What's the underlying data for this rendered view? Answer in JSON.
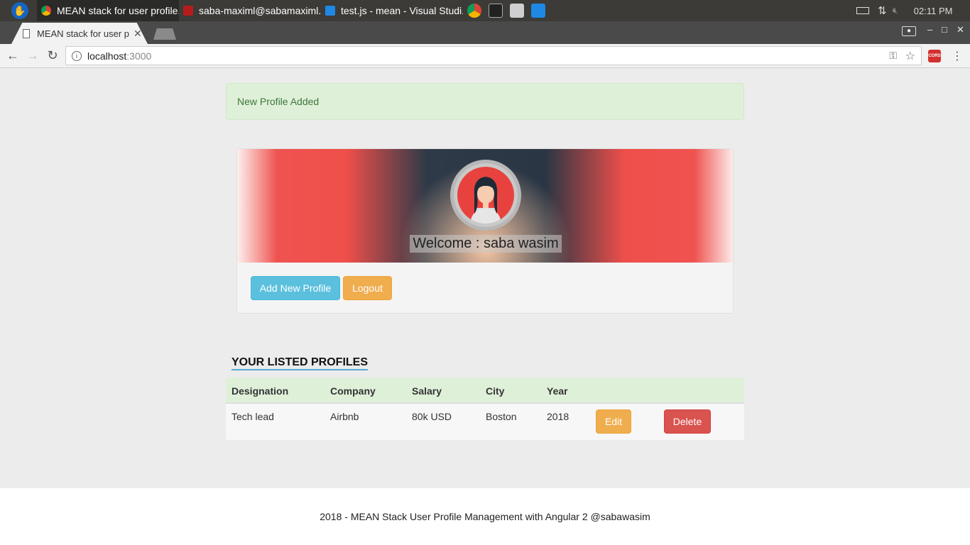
{
  "taskbar": {
    "tasks": [
      {
        "label": "MEAN stack for user profile..."
      },
      {
        "label": "saba-maximl@sabamaximl..."
      },
      {
        "label": "test.js - mean - Visual Studi..."
      }
    ],
    "clock": "02:11 PM"
  },
  "browser": {
    "tab_title": "MEAN stack for user p",
    "url_host": "localhost",
    "url_port": ":3000",
    "cors_label": "CORS"
  },
  "page": {
    "alert": "New Profile Added",
    "welcome": "Welcome : saba wasim",
    "add_profile_label": "Add New Profile",
    "logout_label": "Logout",
    "section_title": "YOUR LISTED PROFILES",
    "table": {
      "headers": [
        "Designation",
        "Company",
        "Salary",
        "City",
        "Year"
      ],
      "rows": [
        {
          "designation": "Tech lead",
          "company": "Airbnb",
          "salary": "80k USD",
          "city": "Boston",
          "year": "2018",
          "edit_label": "Edit",
          "delete_label": "Delete"
        }
      ]
    },
    "footer": "2018 - MEAN Stack User Profile Management with Angular 2 @sabawasim"
  },
  "colors": {
    "alert_bg": "#dff0d8",
    "info": "#5bc0de",
    "warning": "#f0ad4e",
    "danger": "#d9534f"
  }
}
